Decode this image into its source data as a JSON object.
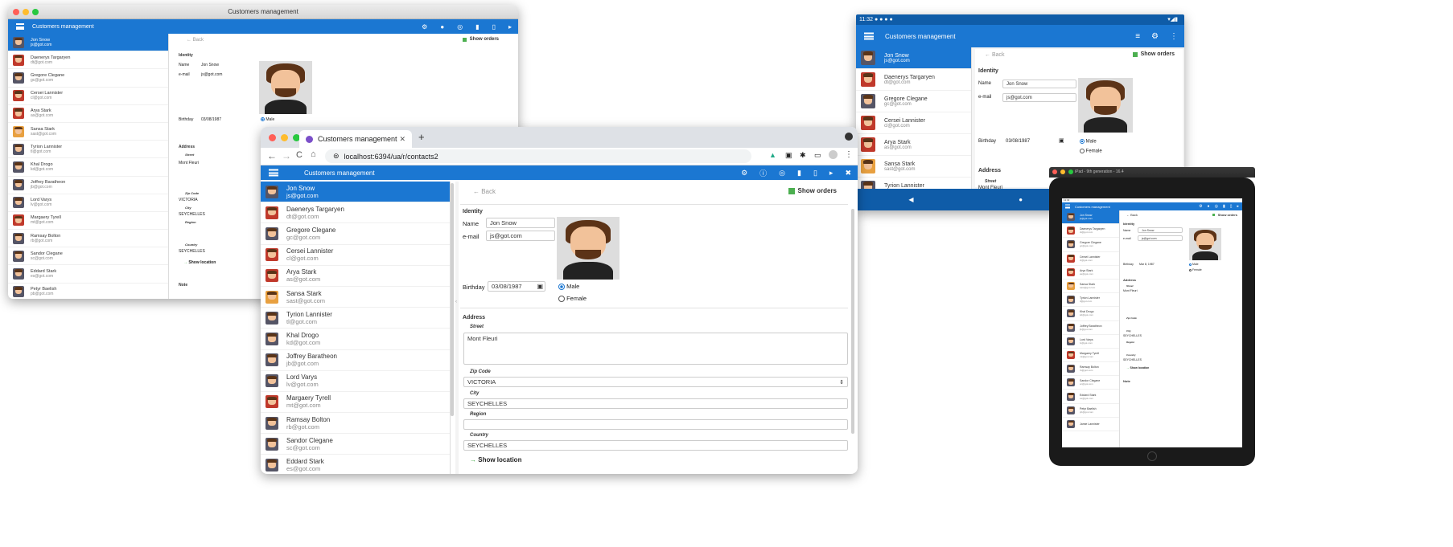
{
  "app": {
    "title": "Customers management"
  },
  "browser": {
    "tab_title": "Customers management",
    "url_host": "localhost",
    "url_rest": ":6394/ua/r/contacts2",
    "new_tab": "+"
  },
  "ipad": {
    "title": "iPad - 9th generation - 16.4",
    "status_time": "11:32"
  },
  "android": {
    "status_time": "11:32"
  },
  "detail": {
    "back": "← Back",
    "show_orders": "Show orders",
    "identity": "Identity",
    "name_label": "Name",
    "name_value": "Jon Snow",
    "email_label": "e-mail",
    "email_value": "js@got.com",
    "birthday_label": "Birthday",
    "birthday_value": "03/08/1987",
    "birthday_value_ipad": "Mar 8, 1987",
    "male": "Male",
    "female": "Female",
    "address": "Address",
    "street": "Street",
    "street_value": "Mont Fleuri",
    "zip": "Zip Code",
    "zip_value": "VICTORIA",
    "city": "City",
    "city_value": "SEYCHELLES",
    "region": "Region",
    "country": "Country",
    "country_value": "SEYCHELLES",
    "show_location": "Show location",
    "note": "Note"
  },
  "contacts": [
    {
      "name": "Jon Snow",
      "email": "js@got.com"
    },
    {
      "name": "Daenerys Targaryen",
      "email": "dt@got.com"
    },
    {
      "name": "Gregore Clegane",
      "email": "gc@got.com"
    },
    {
      "name": "Cersei Lannister",
      "email": "cl@got.com"
    },
    {
      "name": "Arya Stark",
      "email": "as@got.com"
    },
    {
      "name": "Sansa Stark",
      "email": "sast@got.com"
    },
    {
      "name": "Tyrion Lannister",
      "email": "tl@got.com"
    },
    {
      "name": "Khal Drogo",
      "email": "kd@got.com"
    },
    {
      "name": "Joffrey Baratheon",
      "email": "jb@got.com"
    },
    {
      "name": "Lord Varys",
      "email": "lv@got.com"
    },
    {
      "name": "Margaery Tyrell",
      "email": "mt@got.com"
    },
    {
      "name": "Ramsay Bolton",
      "email": "rb@got.com"
    },
    {
      "name": "Sandor Clegane",
      "email": "sc@got.com"
    },
    {
      "name": "Eddard Stark",
      "email": "es@got.com"
    },
    {
      "name": "Petyr Baelish",
      "email": "pb@got.com"
    },
    {
      "name": "Jamie Lannister",
      "email": ""
    }
  ],
  "colors": {
    "accent": "#1b77d2",
    "orders": "#4caf50"
  }
}
